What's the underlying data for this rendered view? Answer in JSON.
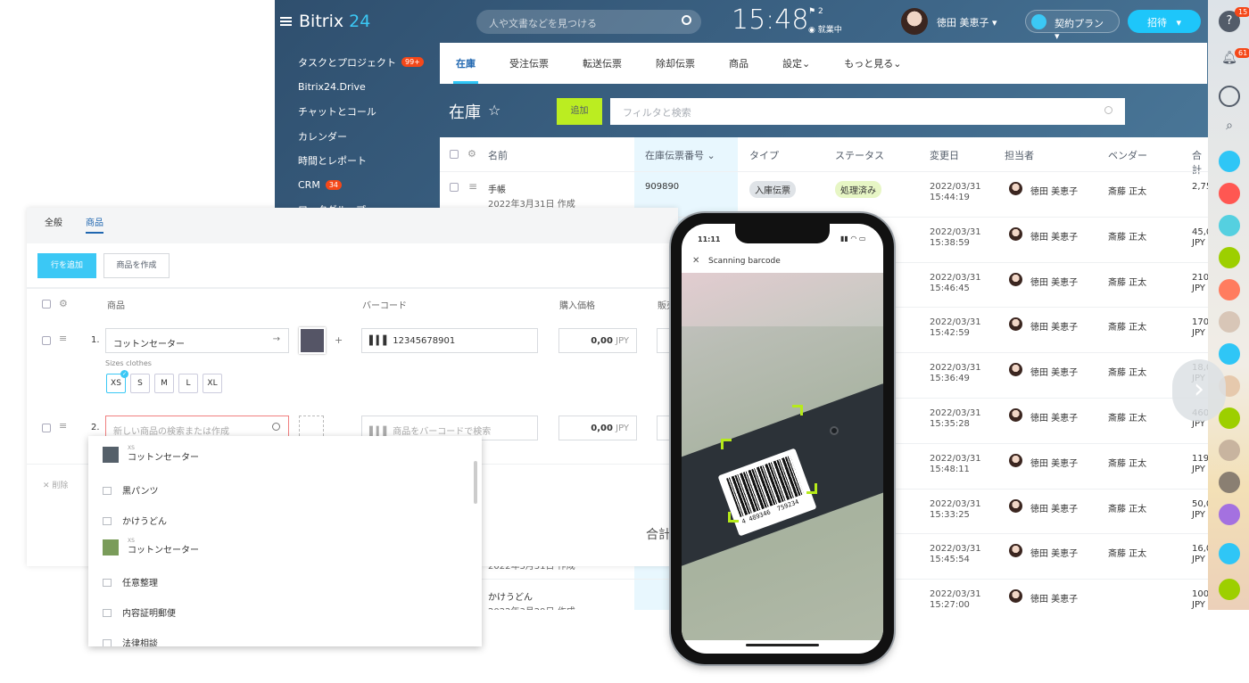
{
  "app": {
    "logo_prefix": "Bitrix",
    "logo_num": "24",
    "search_placeholder": "人や文書などを見つける",
    "clock": "15:48",
    "flag_count": "2",
    "work_status": "就業中",
    "user_name": "徳田 美恵子",
    "plan_label": "契約プラン",
    "invite_label": "招待"
  },
  "menu": [
    {
      "label": "タスクとプロジェクト",
      "badge": "99+"
    },
    {
      "label": "Bitrix24.Drive",
      "badge": ""
    },
    {
      "label": "チャットとコール",
      "badge": ""
    },
    {
      "label": "カレンダー",
      "badge": ""
    },
    {
      "label": "時間とレポート",
      "badge": ""
    },
    {
      "label": "CRM",
      "badge": "34"
    },
    {
      "label": "ワークグループ",
      "badge": ""
    }
  ],
  "tabs": [
    "在庫",
    "受注伝票",
    "転送伝票",
    "除却伝票",
    "商品",
    "設定",
    "もっと見る"
  ],
  "page": {
    "title": "在庫",
    "add_label": "追加",
    "filter_placeholder": "フィルタと検索"
  },
  "grid": {
    "headers": [
      "名前",
      "在庫伝票番号",
      "タイプ",
      "ステータス",
      "変更日",
      "担当者",
      "ベンダー",
      "合計"
    ],
    "rows": [
      {
        "name": "手帳",
        "created": "2022年3月31日 作成",
        "num": "909890",
        "type": "入庫伝票",
        "status": "処理済み",
        "date": "2022/03/31",
        "time": "15:44:19",
        "person": "徳田 美恵子",
        "vendor": "斎藤 正太",
        "total": "2,75",
        "cur": ""
      },
      {
        "name": "",
        "created": "",
        "num": "",
        "type": "",
        "status": "",
        "date": "2022/03/31",
        "time": "15:38:59",
        "person": "徳田 美恵子",
        "vendor": "斎藤 正太",
        "total": "45,0",
        "cur": "JPY"
      },
      {
        "name": "",
        "created": "",
        "num": "",
        "type": "",
        "status": "",
        "date": "2022/03/31",
        "time": "15:46:45",
        "person": "徳田 美恵子",
        "vendor": "斎藤 正太",
        "total": "210",
        "cur": "JPY"
      },
      {
        "name": "",
        "created": "",
        "num": "",
        "type": "",
        "status": "",
        "date": "2022/03/31",
        "time": "15:42:59",
        "person": "徳田 美恵子",
        "vendor": "斎藤 正太",
        "total": "170",
        "cur": "JPY"
      },
      {
        "name": "",
        "created": "",
        "num": "",
        "type": "",
        "status": "",
        "date": "2022/03/31",
        "time": "15:36:49",
        "person": "徳田 美恵子",
        "vendor": "斎藤 正太",
        "total": "18,0",
        "cur": "JPY"
      },
      {
        "name": "",
        "created": "",
        "num": "",
        "type": "",
        "status": "",
        "date": "2022/03/31",
        "time": "15:35:28",
        "person": "徳田 美恵子",
        "vendor": "斎藤 正太",
        "total": "460",
        "cur": "JPY"
      },
      {
        "name": "",
        "created": "",
        "num": "",
        "type": "",
        "status": "",
        "date": "2022/03/31",
        "time": "15:48:11",
        "person": "徳田 美恵子",
        "vendor": "斎藤 正太",
        "total": "119",
        "cur": "JPY"
      },
      {
        "name": "",
        "created": "",
        "num": "",
        "type": "",
        "status": "",
        "date": "2022/03/31",
        "time": "15:33:25",
        "person": "徳田 美恵子",
        "vendor": "斎藤 正太",
        "total": "50,0",
        "cur": "JPY"
      },
      {
        "name": "",
        "created": "2022年3月31日 作成",
        "num": "",
        "type": "",
        "status": "",
        "date": "2022/03/31",
        "time": "15:45:54",
        "person": "徳田 美恵子",
        "vendor": "斎藤 正太",
        "total": "16,0",
        "cur": "JPY"
      },
      {
        "name": "かけうどん",
        "created": "2022年3月29日 作成",
        "num": "",
        "type": "",
        "status": "",
        "date": "2022/03/31",
        "time": "15:27:00",
        "person": "徳田 美恵子",
        "vendor": "",
        "total": "100",
        "cur": "JPY"
      }
    ]
  },
  "rightbar": {
    "help_badge": "15",
    "notif_badge": "61"
  },
  "products": {
    "tab_general": "全般",
    "tab_products": "商品",
    "add_row": "行を追加",
    "create_product": "商品を作成",
    "col_product": "商品",
    "col_barcode": "バーコード",
    "col_price": "購入価格",
    "col_sale": "販売",
    "row1": {
      "num": "1.",
      "name": "コットンセーター",
      "barcode": "12345678901",
      "price": "0,00",
      "currency": "JPY"
    },
    "sizes_label": "Sizes clothes",
    "sizes": [
      "XS",
      "S",
      "M",
      "L",
      "XL"
    ],
    "row2": {
      "num": "2.",
      "search_placeholder": "新しい商品の検索または作成",
      "barcode_placeholder": "商品をバーコードで検索",
      "price": "0,00",
      "currency": "JPY"
    },
    "delete_label": "削除",
    "total_label": "合計"
  },
  "dropdown": [
    {
      "label": "コットンセーター",
      "sub": "XS"
    },
    {
      "label": "黒パンツ",
      "sub": ""
    },
    {
      "label": "かけうどん",
      "sub": ""
    },
    {
      "label": "コットンセーター",
      "sub": "XS"
    },
    {
      "label": "任意整理",
      "sub": ""
    },
    {
      "label": "内容証明郵便",
      "sub": ""
    },
    {
      "label": "法律相談",
      "sub": ""
    }
  ],
  "phone": {
    "time": "11:11",
    "title": "Scanning barcode",
    "barcode_left": "4 489346",
    "barcode_right": "759234"
  }
}
